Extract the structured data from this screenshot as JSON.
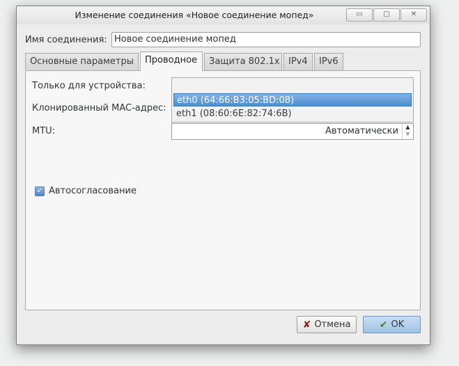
{
  "window": {
    "title": "Изменение соединения «Новое соединение мопед»",
    "controls": {
      "minimize": "▭",
      "maximize": "□",
      "close": "✕"
    }
  },
  "connection_name": {
    "label": "Имя соединения:",
    "value": "Новое соединение мопед"
  },
  "tabs": [
    {
      "label": "Основные параметры",
      "active": false
    },
    {
      "label": "Проводное",
      "active": true
    },
    {
      "label": "Защита 802.1x",
      "active": false
    },
    {
      "label": "IPv4",
      "active": false
    },
    {
      "label": "IPv6",
      "active": false
    }
  ],
  "wired": {
    "device_label": "Только для устройства:",
    "mac_clone_label": "Клонированный MAC-адрес:",
    "device_options": [
      "eth0 (64:66:B3:05:BD:08)",
      "eth1 (08:60:6E:82:74:6B)"
    ],
    "selected_device_index": 0,
    "mtu_label": "MTU:",
    "mtu_value": "Автоматически",
    "autoneg_label": "Автосогласование",
    "autoneg_checked": true
  },
  "buttons": {
    "cancel": "Отмена",
    "ok": "OK"
  },
  "icons": {
    "cancel": "x-mark-icon",
    "ok": "checkmark-icon"
  },
  "colors": {
    "selection": "#4c8fd1",
    "checkbox": "#4f86c6",
    "ok_button": "#9fc3e8"
  }
}
